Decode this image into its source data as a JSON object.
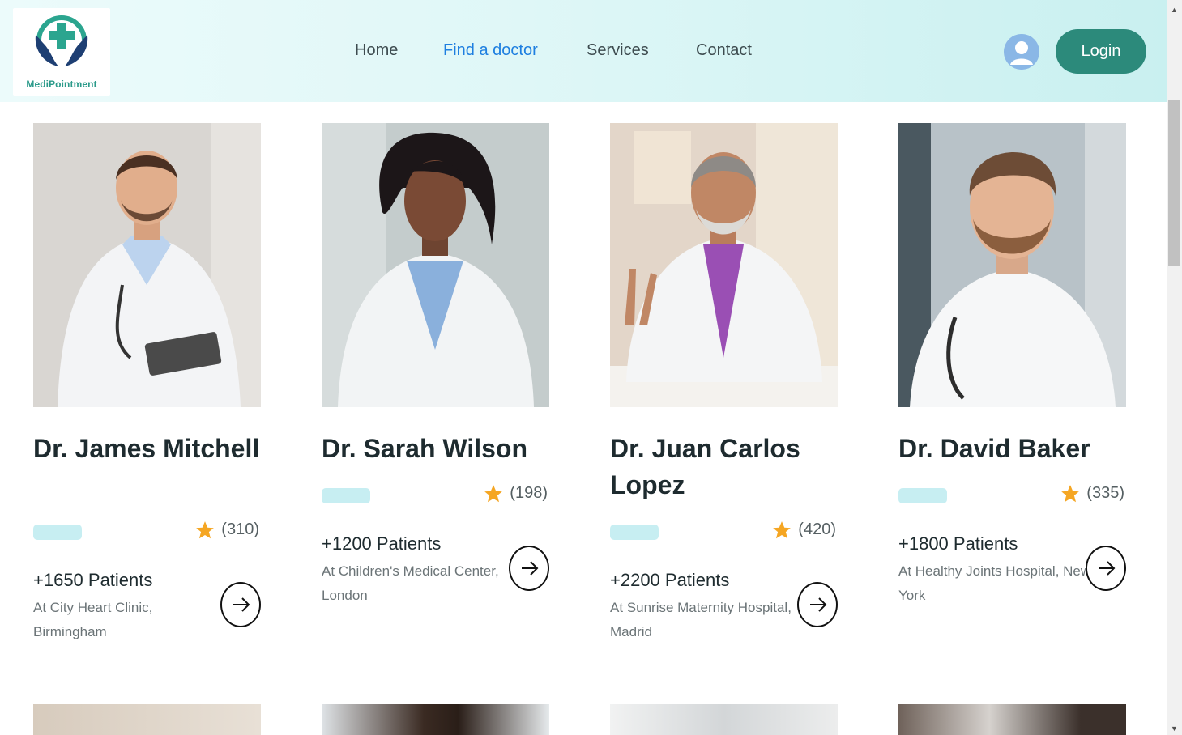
{
  "header": {
    "logo_text": "MediPointment",
    "nav": [
      "Home",
      "Find a doctor",
      "Services",
      "Contact"
    ],
    "active_nav": "Find a doctor",
    "login_label": "Login"
  },
  "doctors": [
    {
      "name": "Dr. James Mitchell",
      "rating": "(310)",
      "patients": "+1650 Patients",
      "location": "At City Heart Clinic, Birmingham"
    },
    {
      "name": "Dr. Sarah Wilson",
      "rating": "(198)",
      "patients": "+1200 Patients",
      "location": "At Children's Medical Center, London"
    },
    {
      "name": "Dr. Juan Carlos Lopez",
      "rating": "(420)",
      "patients": "+2200 Patients",
      "location": "At Sunrise Maternity Hospital, Madrid"
    },
    {
      "name": "Dr. David Baker",
      "rating": "(335)",
      "patients": "+1800 Patients",
      "location": "At Healthy Joints Hospital, New York"
    }
  ],
  "colors": {
    "accent": "#2c8a7b",
    "active_link": "#1e7fe0",
    "star": "#f5a623",
    "pill": "#c7eef2"
  }
}
